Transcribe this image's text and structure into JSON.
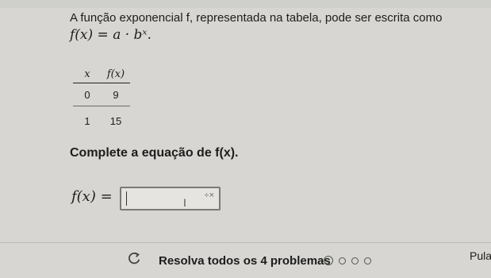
{
  "question": {
    "prompt": "A função exponencial f, representada na tabela, pode ser escrita como",
    "formula": "f(x) = a · bˣ."
  },
  "table": {
    "headers": [
      "x",
      "f(x)"
    ],
    "rows": [
      [
        "0",
        "9"
      ],
      [
        "1",
        "15"
      ]
    ]
  },
  "instruction": "Complete a equação de f(x).",
  "answer": {
    "label": "f(x) =",
    "value": ""
  },
  "footer": {
    "solve_label": "Resolva todos os 4 problemas",
    "progress": {
      "total": 4,
      "current": 1
    },
    "skip_label": "Pula"
  }
}
